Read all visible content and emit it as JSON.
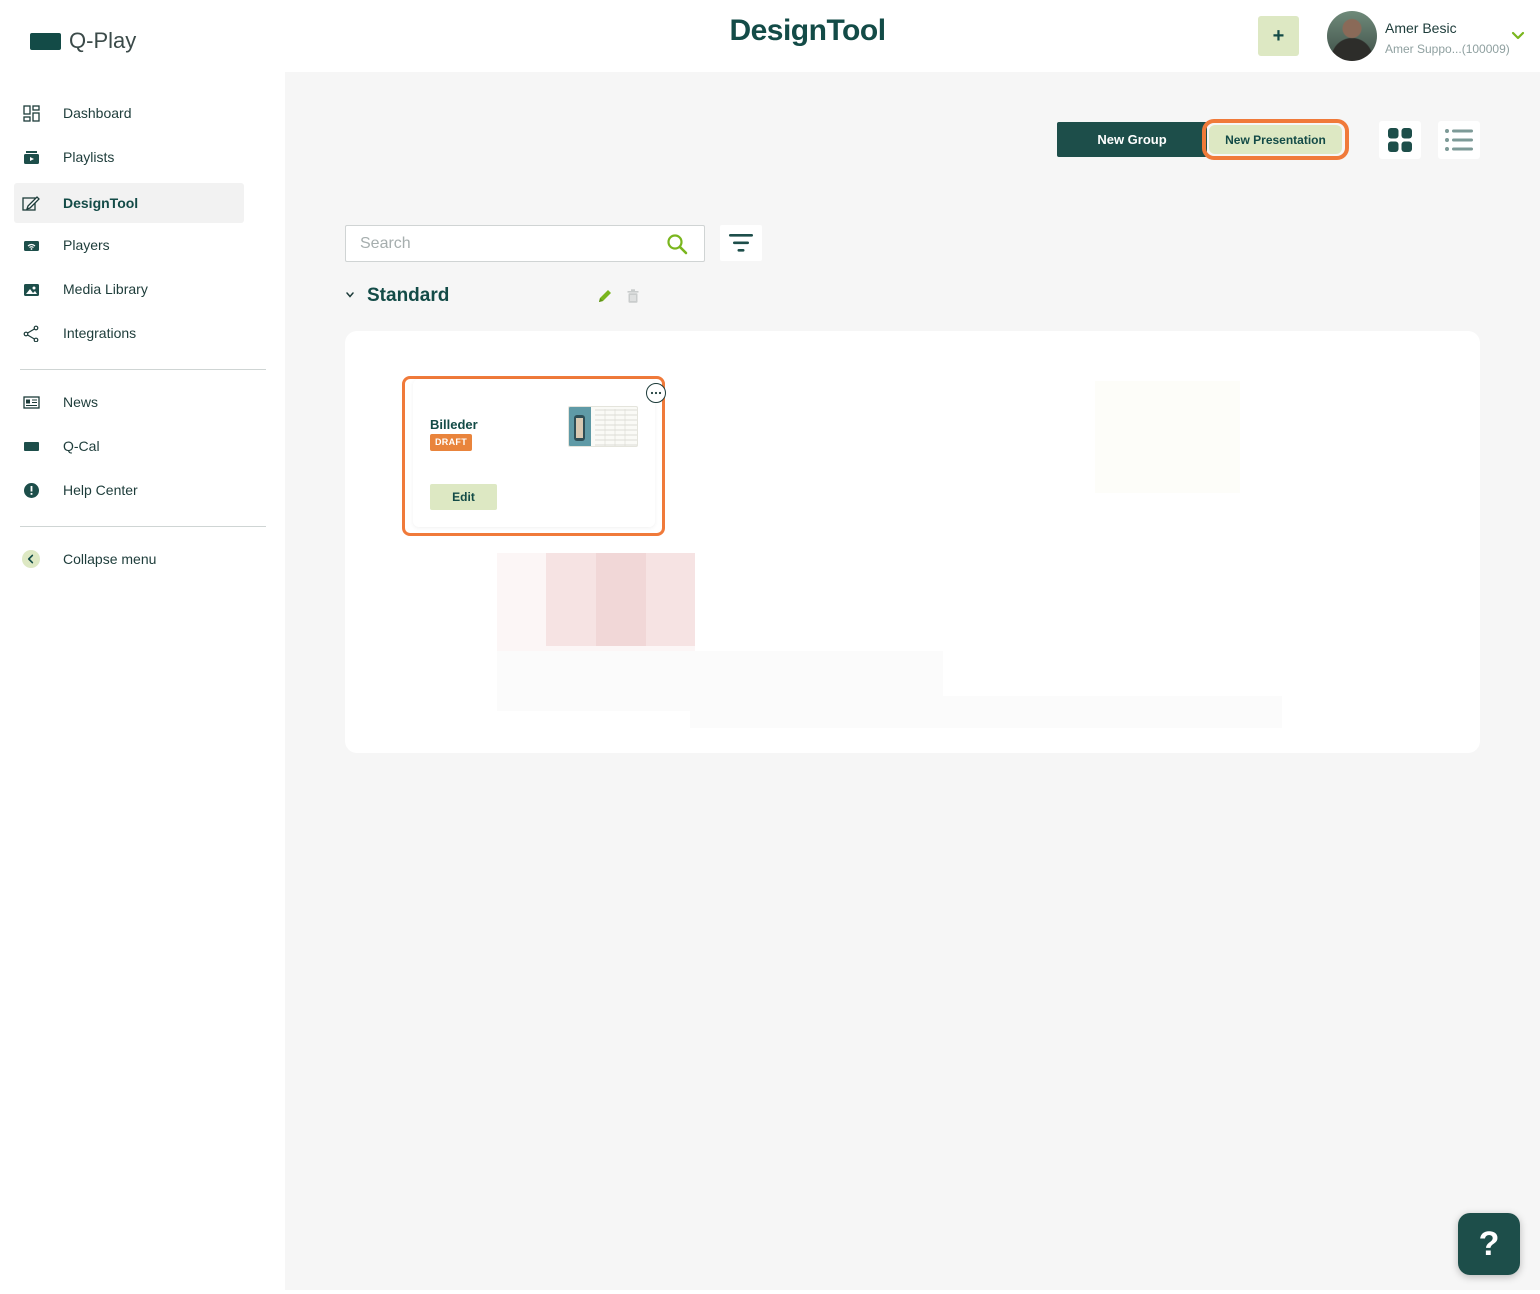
{
  "header": {
    "logo_text": "Q-Play",
    "app_title": "DesignTool",
    "add_button_label": "+",
    "user": {
      "name": "Amer Besic",
      "subtitle": "Amer Suppo...(100009)"
    }
  },
  "sidebar": {
    "items": [
      {
        "label": "Dashboard",
        "icon": "dashboard-icon"
      },
      {
        "label": "Playlists",
        "icon": "playlists-icon"
      },
      {
        "label": "DesignTool",
        "icon": "designtool-icon",
        "active": true
      },
      {
        "label": "Players",
        "icon": "players-icon"
      },
      {
        "label": "Media Library",
        "icon": "media-library-icon"
      },
      {
        "label": "Integrations",
        "icon": "integrations-icon"
      },
      {
        "label": "News",
        "icon": "news-icon"
      },
      {
        "label": "Q-Cal",
        "icon": "qcal-icon"
      },
      {
        "label": "Help Center",
        "icon": "help-center-icon"
      }
    ],
    "collapse_label": "Collapse menu"
  },
  "toolbar": {
    "new_group_label": "New Group",
    "new_presentation_label": "New Presentation",
    "view_mode": "grid"
  },
  "search": {
    "placeholder": "Search",
    "value": ""
  },
  "group": {
    "title": "Standard",
    "presentations": [
      {
        "title": "Billeder",
        "status": "DRAFT",
        "edit_label": "Edit"
      }
    ]
  },
  "help_fab_label": "?",
  "colors": {
    "brand_dark": "#134b47",
    "accent_light": "#dde8c3",
    "highlight_orange": "#f07a3a",
    "draft_badge": "#e9843c",
    "edit_icon_green": "#7ab61e"
  }
}
